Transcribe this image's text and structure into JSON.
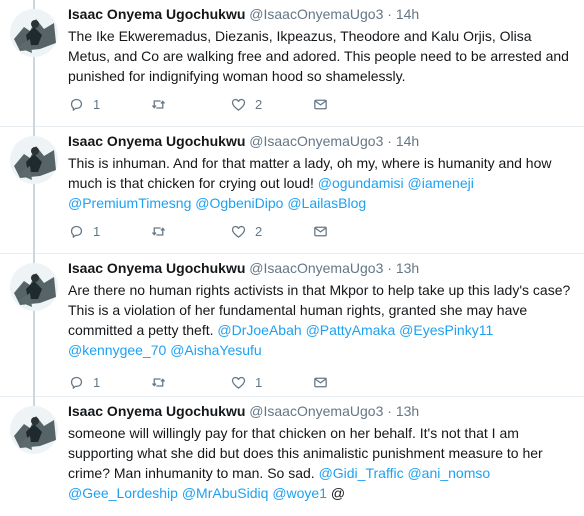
{
  "tweets": [
    {
      "name": "Isaac Onyema Ugochukwu",
      "handle": "@IsaacOnyemaUgo3",
      "dot": "·",
      "time": "14h",
      "body": [
        {
          "t": "The Ike Ekweremadus, Diezanis, Ikpeazus, Theodore and Kalu Orjis, Olisa Metus, and Co are walking free and adored. This people need to be arrested and punished for indignifying woman hood so shamelessly.",
          "m": false
        }
      ],
      "replies": "1",
      "retweets": "",
      "likes": "2"
    },
    {
      "name": "Isaac Onyema Ugochukwu",
      "handle": "@IsaacOnyemaUgo3",
      "dot": "·",
      "time": "14h",
      "body": [
        {
          "t": "This is inhuman. And for that matter a lady, oh my, where is humanity and how much is that chicken for crying out loud! ",
          "m": false
        },
        {
          "t": "@ogundamisi",
          "m": true
        },
        {
          "t": " ",
          "m": false
        },
        {
          "t": "@iameneji",
          "m": true
        },
        {
          "t": " ",
          "m": false
        },
        {
          "t": "@PremiumTimesng",
          "m": true
        },
        {
          "t": " ",
          "m": false
        },
        {
          "t": "@OgbeniDipo",
          "m": true
        },
        {
          "t": " ",
          "m": false
        },
        {
          "t": "@LailasBlog",
          "m": true
        }
      ],
      "replies": "1",
      "retweets": "",
      "likes": "2"
    },
    {
      "name": "Isaac Onyema Ugochukwu",
      "handle": "@IsaacOnyemaUgo3",
      "dot": "·",
      "time": "13h",
      "body": [
        {
          "t": "Are there no human rights activists in that Mkpor to help take up this lady's case? This is a violation of her fundamental human rights, granted she may have committed a petty theft. ",
          "m": false
        },
        {
          "t": "@DrJoeAbah",
          "m": true
        },
        {
          "t": "  ",
          "m": false
        },
        {
          "t": "@PattyAmaka",
          "m": true
        },
        {
          "t": " ",
          "m": false
        },
        {
          "t": "@EyesPinky11",
          "m": true
        },
        {
          "t": " ",
          "m": false
        },
        {
          "t": "@kennygee_70",
          "m": true
        },
        {
          "t": " ",
          "m": false
        },
        {
          "t": "@AishaYesufu",
          "m": true
        }
      ],
      "replies": "1",
      "retweets": "",
      "likes": "1"
    },
    {
      "name": "Isaac Onyema Ugochukwu",
      "handle": "@IsaacOnyemaUgo3",
      "dot": "·",
      "time": "13h",
      "body": [
        {
          "t": "someone will willingly pay for that chicken on her behalf. It's not that I am supporting what she did but does this animalistic  punishment measure to her crime? Man inhumanity to man. So sad. ",
          "m": false
        },
        {
          "t": "@Gidi_Traffic",
          "m": true
        },
        {
          "t": " ",
          "m": false
        },
        {
          "t": "@ani_nomso",
          "m": true
        },
        {
          "t": " ",
          "m": false
        },
        {
          "t": "@Gee_Lordeship",
          "m": true
        },
        {
          "t": " ",
          "m": false
        },
        {
          "t": "@MrAbuSidiq",
          "m": true
        },
        {
          "t": " ",
          "m": false
        },
        {
          "t": "@woye1",
          "m": true
        },
        {
          "t": " @",
          "m": false
        }
      ],
      "replies": "",
      "retweets": "",
      "likes": ""
    }
  ],
  "icons": {
    "reply": "reply-icon",
    "retweet": "retweet-icon",
    "like": "heart-icon",
    "dm": "envelope-icon"
  },
  "colors": {
    "accent": "#1da1f2",
    "secondary_text": "#657786",
    "thread_line": "#ccd6dd",
    "divider": "#e6ecf0"
  }
}
